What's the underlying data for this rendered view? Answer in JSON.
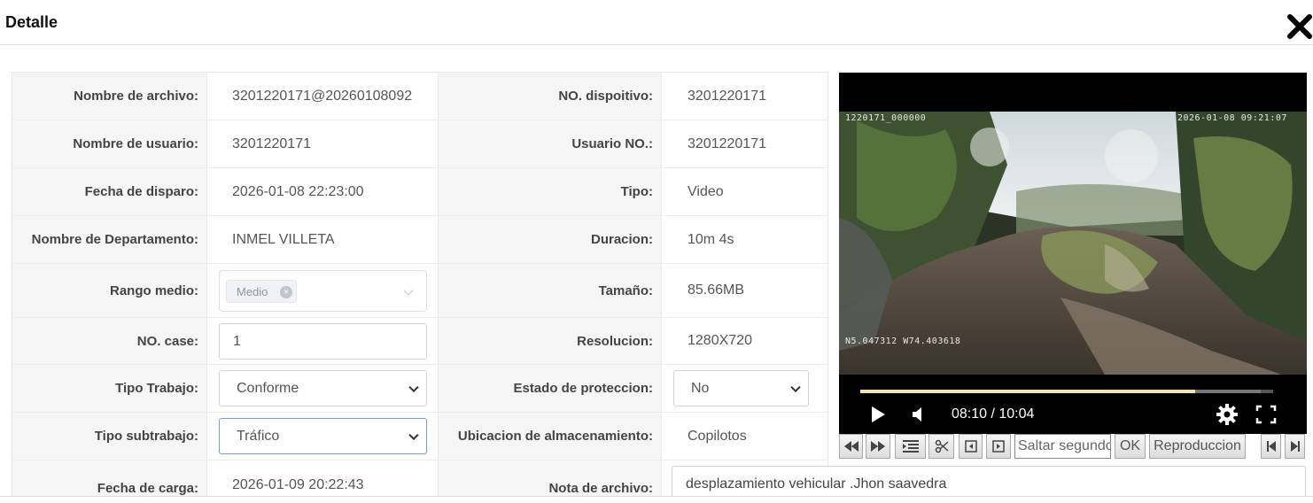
{
  "dialog": {
    "title": "Detalle"
  },
  "fields": {
    "file_name": {
      "label": "Nombre de archivo:",
      "value": "3201220171@20260108092"
    },
    "device_no": {
      "label": "NO. dispoitivo:",
      "value": "3201220171"
    },
    "user_name": {
      "label": "Nombre de usuario:",
      "value": "3201220171"
    },
    "user_no": {
      "label": "Usuario NO.:",
      "value": "3201220171"
    },
    "capture_date": {
      "label": "Fecha de disparo:",
      "value": "2026-01-08 22:23:00"
    },
    "type": {
      "label": "Tipo:",
      "value": "Video"
    },
    "department": {
      "label": "Nombre de Departamento:",
      "value": "INMEL VILLETA"
    },
    "duration": {
      "label": "Duracion:",
      "value": "10m 4s"
    },
    "range": {
      "label": "Rango medio:",
      "tag": "Medio"
    },
    "size": {
      "label": "Tamaño:",
      "value": "85.66MB"
    },
    "case_no": {
      "label": "NO. case:",
      "value": "1"
    },
    "resolution": {
      "label": "Resolucion:",
      "value": "1280X720"
    },
    "work_type": {
      "label": "Tipo Trabajo:",
      "value": "Conforme"
    },
    "protection": {
      "label": "Estado de proteccion:",
      "value": "No"
    },
    "work_subtype": {
      "label": "Tipo subtrabajo:",
      "value": "Tráfico"
    },
    "storage": {
      "label": "Ubicacion de almacenamiento:",
      "value": "Copilotos"
    },
    "upload_date": {
      "label": "Fecha de carga:",
      "value": "2026-01-09 20:22:43"
    },
    "note": {
      "label": "Nota de archivo:",
      "value": "desplazamiento vehicular .Jhon saavedra"
    }
  },
  "player": {
    "osd_top_left": "1220171_000000",
    "osd_top_right": "2026-01-08 09:21:07",
    "osd_bottom_left": "N5.047312 W74.403618",
    "time": "08:10 / 10:04",
    "progress": 0.812,
    "buffered": 0.97
  },
  "toolbar": {
    "seek_placeholder": "Saltar segundos",
    "ok_label": "OK",
    "playback_label": "Reproduccion"
  },
  "colors": {
    "progress": "#f3e3b5",
    "player_bg": "#000000",
    "label_bg": "#f5f5f5"
  }
}
